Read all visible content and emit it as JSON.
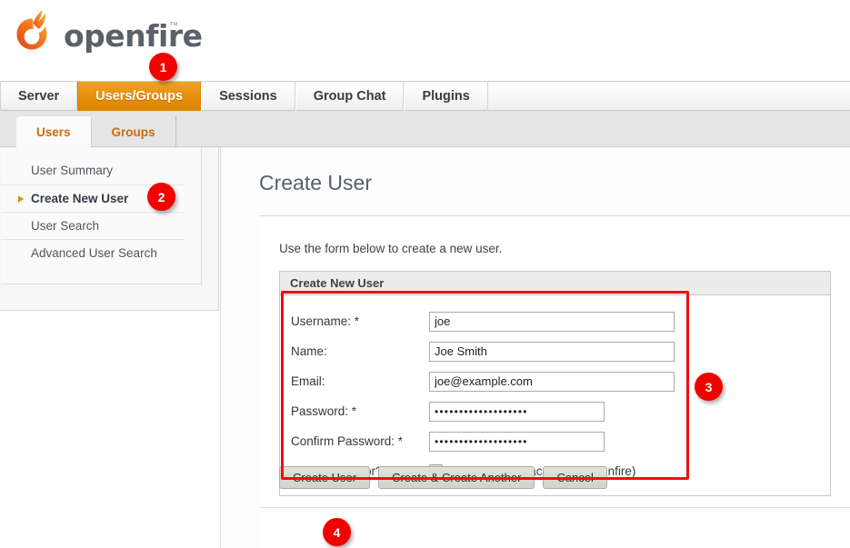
{
  "brand": {
    "name": "openfire",
    "trademark": "™",
    "logo_icon": "openfire-flame-logo",
    "accent_color": "#e58d0c",
    "logo_orange": "#f47b20"
  },
  "primary_tabs": [
    {
      "label": "Server",
      "active": false
    },
    {
      "label": "Users/Groups",
      "active": true
    },
    {
      "label": "Sessions",
      "active": false
    },
    {
      "label": "Group Chat",
      "active": false
    },
    {
      "label": "Plugins",
      "active": false
    }
  ],
  "sub_tabs": [
    {
      "label": "Users",
      "active": true
    },
    {
      "label": "Groups",
      "active": false
    }
  ],
  "sidebar": {
    "items": [
      {
        "label": "User Summary",
        "selected": false
      },
      {
        "label": "Create New User",
        "selected": true
      },
      {
        "label": "User Search",
        "selected": false
      },
      {
        "label": "Advanced User Search",
        "selected": false
      }
    ]
  },
  "main": {
    "page_title": "Create User",
    "description": "Use the form below to create a new user.",
    "panel_heading": "Create New User",
    "fields": [
      {
        "label": "Username: *",
        "value": "joe",
        "type": "text",
        "name": "username-field"
      },
      {
        "label": "Name:",
        "value": "Joe Smith",
        "type": "text",
        "name": "name-field"
      },
      {
        "label": "Email:",
        "value": "joe@example.com",
        "type": "text",
        "name": "email-field"
      },
      {
        "label": "Password: *",
        "value": "•••••••••••••••••••",
        "type": "password",
        "name": "password-field"
      },
      {
        "label": "Confirm Password: *",
        "value": "•••••••••••••••••••",
        "type": "password",
        "name": "confirm-password-field"
      }
    ],
    "admin_row": {
      "label": "Is Administrator?",
      "note": "(Grants admin access to Openfire)",
      "checked": false
    },
    "buttons": [
      {
        "label": "Create User",
        "name": "create-user-button"
      },
      {
        "label": "Create & Create Another",
        "name": "create-and-create-another-button"
      },
      {
        "label": "Cancel",
        "name": "cancel-button"
      }
    ]
  },
  "annotations": {
    "highlight_color": "#f20d0d",
    "badges": [
      {
        "number": "1",
        "target": "users-groups-tab"
      },
      {
        "number": "2",
        "target": "sidebar-item-create-new-user"
      },
      {
        "number": "3",
        "target": "create-user-form-fields"
      },
      {
        "number": "4",
        "target": "create-user-button"
      }
    ]
  }
}
